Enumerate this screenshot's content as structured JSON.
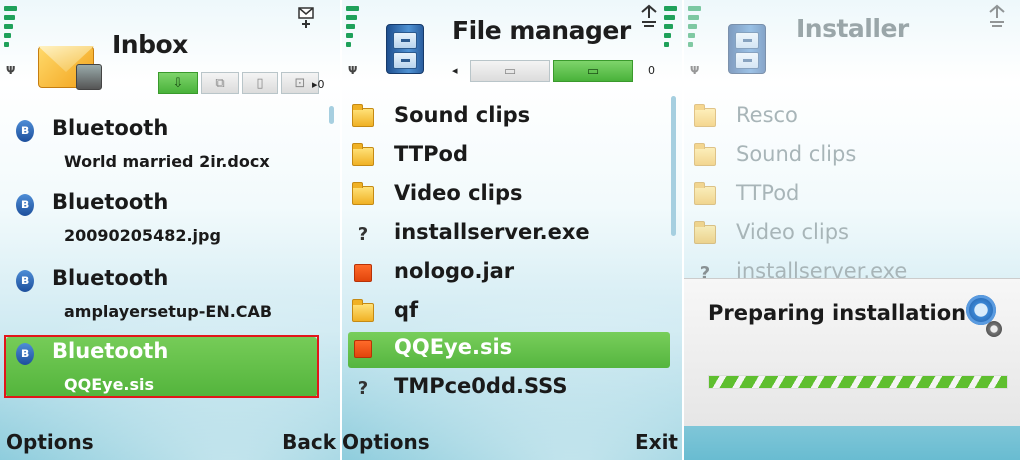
{
  "colors": {
    "selected_green": "#5bb843",
    "highlight_outline": "#e2161a",
    "tab_active": "#56b63f"
  },
  "inbox": {
    "title": "Inbox",
    "icon": "inbox-envelope-icon",
    "items": [
      {
        "source": "Bluetooth",
        "file": "World married 2ir.docx",
        "selected": false
      },
      {
        "source": "Bluetooth",
        "file": "20090205482.jpg",
        "selected": false
      },
      {
        "source": "Bluetooth",
        "file": "amplayersetup-EN.CAB",
        "selected": false
      },
      {
        "source": "Bluetooth",
        "file": "QQEye.sis",
        "selected": true
      }
    ],
    "softkeys": {
      "left": "Options",
      "right": "Back"
    }
  },
  "file_manager": {
    "title": "File manager",
    "icon": "file-cabinet-icon",
    "items": [
      {
        "name": "Sound clips",
        "icon": "folder-icon"
      },
      {
        "name": "TTPod",
        "icon": "folder-icon"
      },
      {
        "name": "Video clips",
        "icon": "folder-icon"
      },
      {
        "name": "installserver.exe",
        "icon": "unknown-file-icon"
      },
      {
        "name": "nologo.jar",
        "icon": "java-file-icon"
      },
      {
        "name": "qf",
        "icon": "folder-icon"
      },
      {
        "name": "QQEye.sis",
        "icon": "sis-file-icon",
        "selected": true
      },
      {
        "name": "TMPce0dd.SSS",
        "icon": "unknown-file-icon"
      }
    ],
    "tab_count": "0",
    "softkeys": {
      "left": "Options",
      "right": "Exit"
    }
  },
  "installer": {
    "title": "Installer",
    "icon": "file-cabinet-icon",
    "items": [
      {
        "name": "Resco",
        "icon": "folder-icon"
      },
      {
        "name": "Sound clips",
        "icon": "folder-icon"
      },
      {
        "name": "TTPod",
        "icon": "folder-icon"
      },
      {
        "name": "Video clips",
        "icon": "folder-icon"
      },
      {
        "name": "installserver.exe",
        "icon": "unknown-file-icon"
      }
    ],
    "dialog": {
      "message": "Preparing installation"
    }
  }
}
